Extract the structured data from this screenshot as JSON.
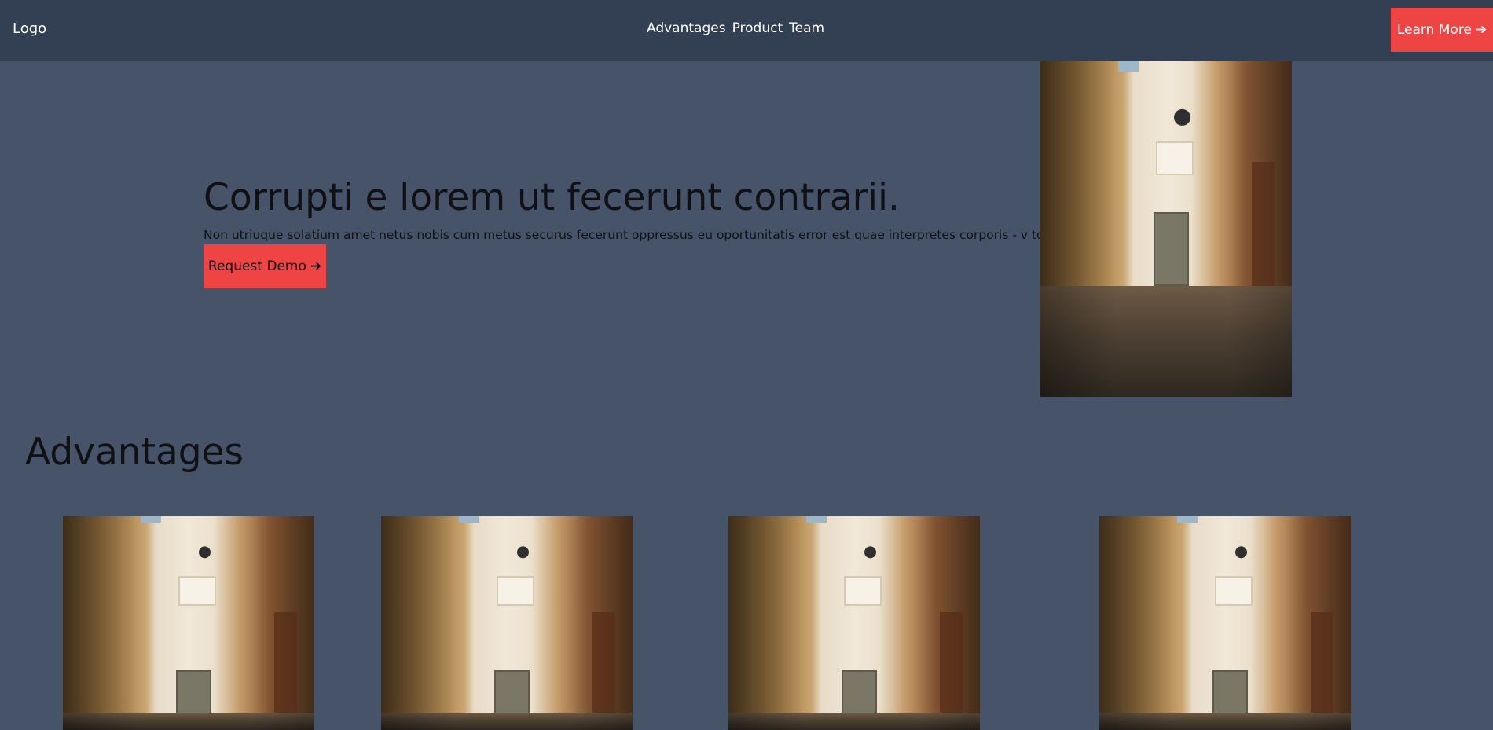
{
  "navbar": {
    "logo": "Logo",
    "links": [
      "Advantages",
      "Product",
      "Team"
    ],
    "cta_label": "Learn More",
    "cta_icon": "arrow-right-icon"
  },
  "hero": {
    "title": "Corrupti e lorem ut fecerunt contrarii.",
    "text": "Non utriuque solatium amet netus nobis cum metus securus fecerunt oppressus eu oportunitatis error est quae interpretes corporis - v tot ullo s Verius.",
    "button_label": "Request Demo",
    "button_icon": "arrow-right-icon"
  },
  "advantages": {
    "title": "Advantages",
    "card_count": 4
  },
  "colors": {
    "background": "#465369",
    "navbar": "#333f53",
    "accent": "#ef4444",
    "text_dark": "#0f1115",
    "text_light": "#ffffff"
  }
}
